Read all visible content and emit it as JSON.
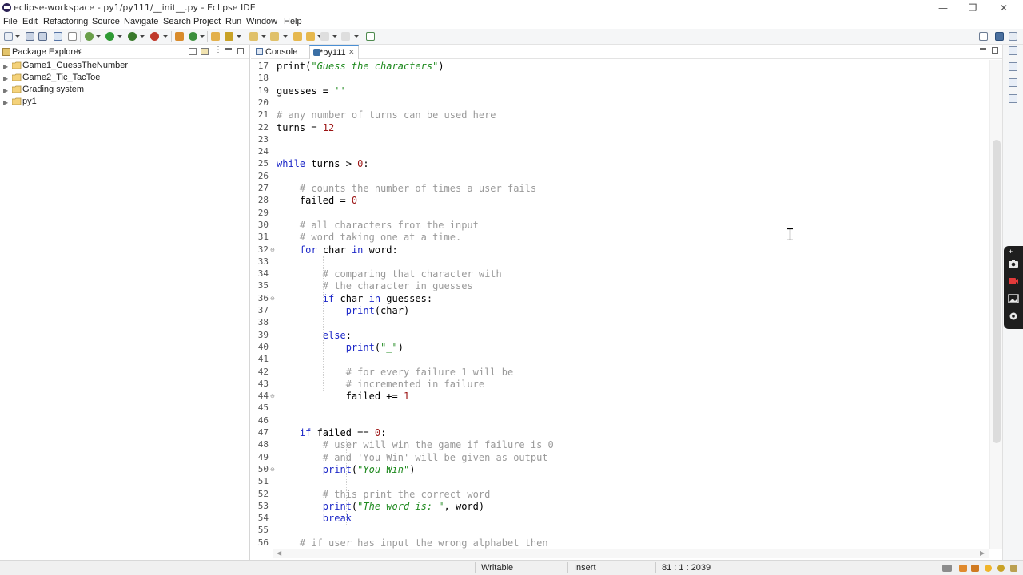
{
  "window": {
    "title": "eclipse-workspace - py1/py111/__init__.py - Eclipse IDE",
    "controls": [
      "—",
      "❐",
      "✕"
    ]
  },
  "menu": [
    "File",
    "Edit",
    "Refactoring",
    "Source",
    "Navigate",
    "Search",
    "Project",
    "Run",
    "Window",
    "Help"
  ],
  "package_explorer": {
    "tab_label": "Package Explorer",
    "close": "✕",
    "projects": [
      "Game1_GuessTheNumber",
      "Game2_Tic_TacToe",
      "Grading system",
      "py1"
    ]
  },
  "editor": {
    "tabs": [
      {
        "label": "Console",
        "active": false
      },
      {
        "label": "*py111",
        "active": true,
        "close": "✕"
      }
    ],
    "line_numbers": [
      "17",
      "18",
      "19",
      "20",
      "21",
      "22",
      "23",
      "24",
      "25",
      "26",
      "27",
      "28",
      "29",
      "30",
      "31",
      "32",
      "33",
      "34",
      "35",
      "36",
      "37",
      "38",
      "39",
      "40",
      "41",
      "42",
      "43",
      "44",
      "45",
      "46",
      "47",
      "48",
      "49",
      "50",
      "51",
      "52",
      "53",
      "54",
      "55",
      "56"
    ],
    "fold_markers": {
      "32": "⊖",
      "36": "⊖",
      "44": "⊖",
      "50": "⊖"
    },
    "lines": [
      [
        {
          "t": "print(",
          "c": "plain"
        },
        {
          "t": "\"Guess the characters\"",
          "c": "str"
        },
        {
          "t": ")",
          "c": "plain"
        }
      ],
      [],
      [
        {
          "t": "guesses = ",
          "c": "plain"
        },
        {
          "t": "''",
          "c": "str"
        }
      ],
      [],
      [
        {
          "t": "# any number of turns can be used here",
          "c": "cm"
        }
      ],
      [
        {
          "t": "turns = ",
          "c": "plain"
        },
        {
          "t": "12",
          "c": "num"
        }
      ],
      [],
      [],
      [
        {
          "t": "while",
          "c": "kw"
        },
        {
          "t": " turns > ",
          "c": "plain"
        },
        {
          "t": "0",
          "c": "num"
        },
        {
          "t": ":",
          "c": "plain"
        }
      ],
      [],
      [
        {
          "t": "    # counts the number of times a user fails",
          "c": "cm"
        }
      ],
      [
        {
          "t": "    failed = ",
          "c": "plain"
        },
        {
          "t": "0",
          "c": "num"
        }
      ],
      [],
      [
        {
          "t": "    # all characters from the input",
          "c": "cm"
        }
      ],
      [
        {
          "t": "    # word taking one at a time.",
          "c": "cm"
        }
      ],
      [
        {
          "t": "    ",
          "c": "plain"
        },
        {
          "t": "for",
          "c": "kw"
        },
        {
          "t": " char ",
          "c": "plain"
        },
        {
          "t": "in",
          "c": "kw"
        },
        {
          "t": " word:",
          "c": "plain"
        }
      ],
      [],
      [
        {
          "t": "        # comparing that character with",
          "c": "cm"
        }
      ],
      [
        {
          "t": "        # the character in guesses",
          "c": "cm"
        }
      ],
      [
        {
          "t": "        ",
          "c": "plain"
        },
        {
          "t": "if",
          "c": "kw"
        },
        {
          "t": " char ",
          "c": "plain"
        },
        {
          "t": "in",
          "c": "kw"
        },
        {
          "t": " guesses:",
          "c": "plain"
        }
      ],
      [
        {
          "t": "            ",
          "c": "plain"
        },
        {
          "t": "print",
          "c": "kw"
        },
        {
          "t": "(char)",
          "c": "plain"
        }
      ],
      [],
      [
        {
          "t": "        ",
          "c": "plain"
        },
        {
          "t": "else",
          "c": "kw"
        },
        {
          "t": ":",
          "c": "plain"
        }
      ],
      [
        {
          "t": "            ",
          "c": "plain"
        },
        {
          "t": "print",
          "c": "kw"
        },
        {
          "t": "(",
          "c": "plain"
        },
        {
          "t": "\"_\"",
          "c": "str"
        },
        {
          "t": ")",
          "c": "plain"
        }
      ],
      [],
      [
        {
          "t": "            # for every failure 1 will be",
          "c": "cm"
        }
      ],
      [
        {
          "t": "            # incremented in failure",
          "c": "cm"
        }
      ],
      [
        {
          "t": "            failed += ",
          "c": "plain"
        },
        {
          "t": "1",
          "c": "num"
        }
      ],
      [],
      [],
      [
        {
          "t": "    ",
          "c": "plain"
        },
        {
          "t": "if",
          "c": "kw"
        },
        {
          "t": " failed == ",
          "c": "plain"
        },
        {
          "t": "0",
          "c": "num"
        },
        {
          "t": ":",
          "c": "plain"
        }
      ],
      [
        {
          "t": "        # user will win the game if failure is 0",
          "c": "cm"
        }
      ],
      [
        {
          "t": "        # and 'You Win' will be given as output",
          "c": "cm"
        }
      ],
      [
        {
          "t": "        ",
          "c": "plain"
        },
        {
          "t": "print",
          "c": "kw"
        },
        {
          "t": "(",
          "c": "plain"
        },
        {
          "t": "\"You Win\"",
          "c": "str"
        },
        {
          "t": ")",
          "c": "plain"
        }
      ],
      [],
      [
        {
          "t": "        # this print the correct word",
          "c": "cm"
        }
      ],
      [
        {
          "t": "        ",
          "c": "plain"
        },
        {
          "t": "print",
          "c": "kw"
        },
        {
          "t": "(",
          "c": "plain"
        },
        {
          "t": "\"The word is: \"",
          "c": "str"
        },
        {
          "t": ", word)",
          "c": "plain"
        }
      ],
      [
        {
          "t": "        ",
          "c": "plain"
        },
        {
          "t": "break",
          "c": "kw"
        }
      ],
      [],
      [
        {
          "t": "    # if user has input the wrong alphabet then",
          "c": "cm"
        }
      ]
    ]
  },
  "status": {
    "mode": "Writable",
    "insert": "Insert",
    "position": "81 : 1 : 2039"
  },
  "colors": {
    "keyword": "#1d28c8",
    "string": "#1f8a1f",
    "comment": "#9a9a9a",
    "number": "#9c1515",
    "active_tab_accent": "#4a8fd4"
  },
  "icons": [
    "eclipse-logo-icon",
    "save-icon",
    "debug-icon",
    "run-icon",
    "search-icon",
    "perspective-icon",
    "folder-icon",
    "camera-icon",
    "record-icon",
    "gallery-icon",
    "settings-icon"
  ]
}
